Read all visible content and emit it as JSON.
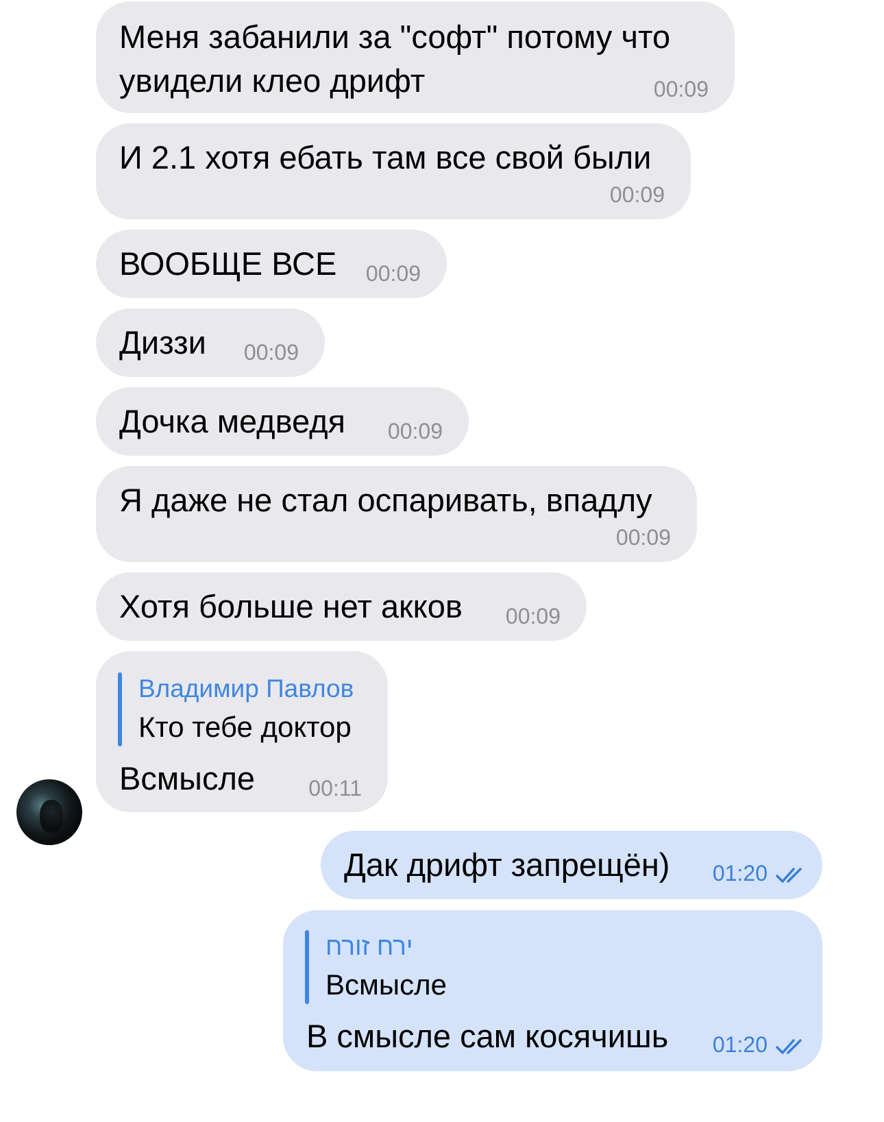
{
  "messages": [
    {
      "text_line1": "Меня забанили за \"софт\" потому что",
      "text_line2": "увидели клео дрифт",
      "time": "00:09"
    },
    {
      "text": "И 2.1 хотя ебать там все свой были",
      "time": "00:09"
    },
    {
      "text": "ВООБЩЕ ВСЕ",
      "time": "00:09"
    },
    {
      "text": "Диззи",
      "time": "00:09"
    },
    {
      "text": "Дочка медведя",
      "time": "00:09"
    },
    {
      "text": "Я даже не стал оспаривать, впадлу",
      "time": "00:09"
    },
    {
      "text": "Хотя больше нет акков",
      "time": "00:09"
    },
    {
      "reply_name": "Владимир Павлов",
      "reply_text": "Кто тебе доктор",
      "text": "Всмысле",
      "time": "00:11"
    }
  ],
  "outgoing": [
    {
      "text": "Дак дрифт запрещён)",
      "time": "01:20",
      "status_icon": "double-check-icon"
    },
    {
      "reply_name": "ירח זורח",
      "reply_text": "Всмысле",
      "text": "В смысле сам косячишь",
      "time": "01:20",
      "status_icon": "double-check-icon"
    }
  ],
  "colors": {
    "incoming_bubble": "#e9e9ed",
    "outgoing_bubble": "#d4e3fa",
    "accent": "#3f86e0",
    "time_gray": "#8e8e93"
  }
}
